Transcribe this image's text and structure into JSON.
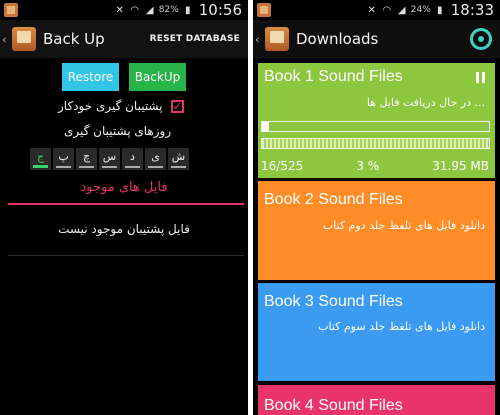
{
  "left": {
    "status_battery": "82%",
    "status_time": "10:56",
    "title": "Back Up",
    "reset_label": "RESET DATABASE",
    "restore_label": "Restore",
    "backup_label": "BackUp",
    "auto_backup_label": "پشتیبان گیری خودکار",
    "auto_backup_checked": true,
    "backup_days_label": "روزهای پشتیبان گیری",
    "days": [
      "ش",
      "ی",
      "د",
      "س",
      "چ",
      "پ",
      "ج"
    ],
    "active_day": "ج",
    "files_section_title": "فایل های موجود",
    "empty_message": "فایل پشتیبان موجود نیست"
  },
  "right": {
    "status_battery": "24%",
    "status_time": "18:33",
    "title": "Downloads",
    "cards": [
      {
        "title": "Book 1 Sound Files",
        "subtitle": "در حال دریافت فایل ها ...",
        "color": "#8dc63f",
        "progress_percent": 3,
        "files_done": "16/525",
        "percent_label": "3 %",
        "size_label": "31.95 MB"
      },
      {
        "title": "Book 2 Sound Files",
        "subtitle": "دانلود فایل های تلفظ جلد دوم کتاب",
        "color": "#ff8c27"
      },
      {
        "title": "Book 3 Sound Files",
        "subtitle": "دانلود فایل های تلفظ جلد سوم کتاب",
        "color": "#3a9bf0"
      },
      {
        "title": "Book 4 Sound Files",
        "color": "#e8336d"
      }
    ]
  },
  "colors": {
    "accent_pink": "#e6326f",
    "restore_blue": "#31c6e6",
    "backup_green": "#27b54a",
    "active_day_green": "#35d36b",
    "gear_teal": "#3fd0c0"
  },
  "icons": [
    "app-icon",
    "mute-icon",
    "wifi-icon",
    "signal-icon",
    "battery-icon",
    "back-chevron-icon",
    "app-logo-icon",
    "checkbox-checked-icon",
    "pause-icon",
    "settings-gear-icon"
  ]
}
